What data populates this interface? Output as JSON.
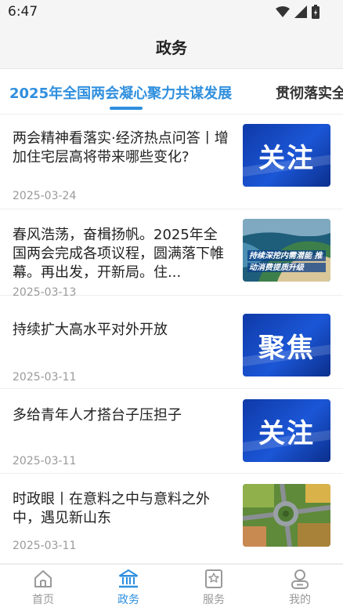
{
  "status_bar": {
    "time": "6:47"
  },
  "header": {
    "title": "政务"
  },
  "tabs": [
    {
      "label": "2025年全国两会凝心聚力共谋发展"
    },
    {
      "label": "贯彻落实全"
    }
  ],
  "articles": [
    {
      "title": "两会精神看落实·经济热点问答丨增加住宅层高将带来哪些变化?",
      "date": "2025-03-24",
      "thumb_text": "关注"
    },
    {
      "title": "春风浩荡，奋楫扬帆。2025年全国两会完成各项议程，圆满落下帷幕。再出发，开新局。住...",
      "date": "2025-03-13",
      "thumb_text": "持续深挖内需潜能 推动消费提质升级"
    },
    {
      "title": "持续扩大高水平对外开放",
      "date": "2025-03-11",
      "thumb_text": "聚焦"
    },
    {
      "title": "多给青年人才搭台子压担子",
      "date": "2025-03-11",
      "thumb_text": "关注"
    },
    {
      "title": "时政眼丨在意料之中与意料之外中，遇见新山东",
      "date": "2025-03-11",
      "thumb_text": ""
    }
  ],
  "bottom_nav": [
    {
      "label": "首页",
      "icon": "home-icon"
    },
    {
      "label": "政务",
      "icon": "government-building-icon"
    },
    {
      "label": "服务",
      "icon": "service-bookmark-icon"
    },
    {
      "label": "我的",
      "icon": "profile-icon"
    }
  ],
  "colors": {
    "accent": "#2f8fde",
    "thumb_blue": "#1b56d6",
    "date_gray": "#9a9a9a"
  }
}
